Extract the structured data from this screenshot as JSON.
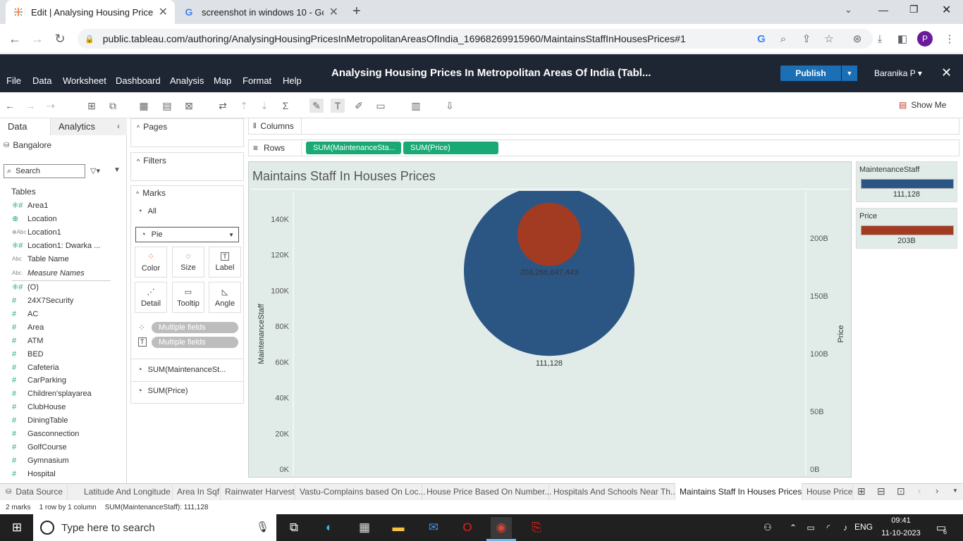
{
  "browser": {
    "tabs": [
      {
        "title": "Edit | Analysing Housing Prices I",
        "active": true
      },
      {
        "title": "screenshot in windows 10 - Goo",
        "active": false
      }
    ],
    "url": "public.tableau.com/authoring/AnalysingHousingPricesInMetropolitanAreasOfIndia_16968269915960/MaintainsStaffInHousesPrices#1",
    "profile_initial": "P"
  },
  "tableau": {
    "menu": [
      "File",
      "Data",
      "Worksheet",
      "Dashboard",
      "Analysis",
      "Map",
      "Format",
      "Help"
    ],
    "workbook_title": "Analysing Housing Prices In Metropolitan Areas Of India (Tabl...",
    "publish_label": "Publish",
    "user_label": "Baranika P ▾",
    "show_me": "Show Me"
  },
  "datapane": {
    "tab_data": "Data",
    "tab_analytics": "Analytics",
    "datasource": "Bangalore",
    "search_placeholder": "Search",
    "tables_label": "Tables",
    "fields": [
      {
        "name": "Area1",
        "icon": "hash-geo"
      },
      {
        "name": "Location",
        "icon": "globe"
      },
      {
        "name": "Location1",
        "icon": "abc-geo"
      },
      {
        "name": "Location1: Dwarka ...",
        "icon": "hash-geo"
      },
      {
        "name": "Table Name",
        "icon": "abc"
      },
      {
        "name": "Measure Names",
        "icon": "abc"
      },
      {
        "name": "(O)",
        "icon": "hash-geo"
      },
      {
        "name": "24X7Security",
        "icon": "hash"
      },
      {
        "name": "AC",
        "icon": "hash"
      },
      {
        "name": "Area",
        "icon": "hash"
      },
      {
        "name": "ATM",
        "icon": "hash"
      },
      {
        "name": "BED",
        "icon": "hash"
      },
      {
        "name": "Cafeteria",
        "icon": "hash"
      },
      {
        "name": "CarParking",
        "icon": "hash"
      },
      {
        "name": "Children'splayarea",
        "icon": "hash"
      },
      {
        "name": "ClubHouse",
        "icon": "hash"
      },
      {
        "name": "DiningTable",
        "icon": "hash"
      },
      {
        "name": "Gasconnection",
        "icon": "hash"
      },
      {
        "name": "GolfCourse",
        "icon": "hash"
      },
      {
        "name": "Gymnasium",
        "icon": "hash"
      },
      {
        "name": "Hospital",
        "icon": "hash"
      }
    ]
  },
  "cards": {
    "pages": "Pages",
    "filters": "Filters",
    "marks": "Marks",
    "all": "All",
    "mark_type": "Pie",
    "buttons": [
      "Color",
      "Size",
      "Label",
      "Detail",
      "Tooltip",
      "Angle"
    ],
    "multiple_fields": "Multiple fields",
    "measures": [
      "SUM(MaintenanceSt...",
      "SUM(Price)"
    ]
  },
  "shelves": {
    "columns_label": "Columns",
    "rows_label": "Rows",
    "rows_pills": [
      "SUM(MaintenanceSta...",
      "SUM(Price)"
    ]
  },
  "chart_data": {
    "type": "pie",
    "title": "Maintains Staff In Houses Prices",
    "ylabel_left": "MaintenanceStaff",
    "ylabel_right": "Price",
    "left_ticks": [
      "140K",
      "120K",
      "100K",
      "80K",
      "60K",
      "40K",
      "20K",
      "0K"
    ],
    "right_ticks": [
      "200B",
      "150B",
      "100B",
      "50B",
      "0B"
    ],
    "ylim_left": [
      0,
      150000
    ],
    "ylim_right": [
      0,
      220000000000
    ],
    "series": [
      {
        "name": "MaintenanceStaff",
        "value": 111128,
        "label": "111,128",
        "color": "#2b5684"
      },
      {
        "name": "Price",
        "value": 203266647443,
        "label": "203,266,647,443",
        "color": "#a23b22"
      }
    ]
  },
  "legends": [
    {
      "title": "MaintenanceStaff",
      "value": "111,128",
      "color": "#2b5684"
    },
    {
      "title": "Price",
      "value": "203B",
      "color": "#a23b22"
    }
  ],
  "sheet_tabs": {
    "datasource": "Data Source",
    "tabs": [
      "Latitude And Longitude",
      "Area In Sqf",
      "Rainwater Harvest",
      "Vastu-Complains based On Loc...",
      "House Price Based On Number...",
      "Hospitals And Schools Near Th...",
      "Maintains Staff In Houses Prices",
      "House Price"
    ],
    "active_index": 6
  },
  "status": {
    "marks": "2 marks",
    "rows": "1 row by 1 column",
    "sum": "SUM(MaintenanceStaff): 111,128"
  },
  "taskbar": {
    "search_placeholder": "Type here to search",
    "lang": "ENG",
    "time": "09:41",
    "date": "11-10-2023",
    "notif_count": "6"
  }
}
